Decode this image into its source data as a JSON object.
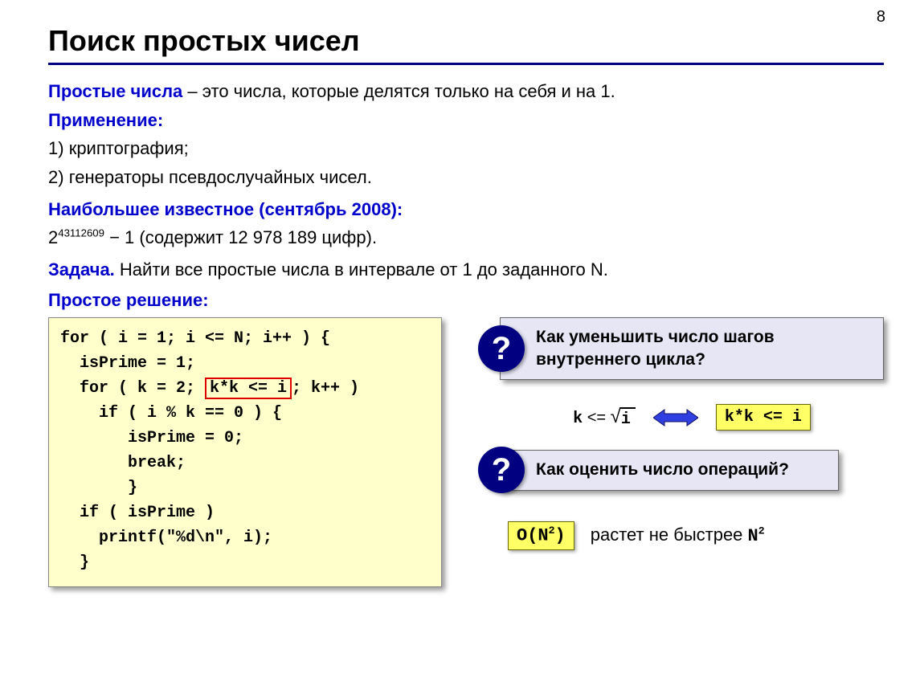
{
  "page_number": "8",
  "title": "Поиск простых чисел",
  "def_label": "Простые числа",
  "def_rest": " – это числа, которые делятся только на себя и на 1.",
  "app_label": "Применение:",
  "app_item1_num": "1)",
  "app_item1_text": "криптография;",
  "app_item2_num": "2)",
  "app_item2_text": "генераторы псевдослучайных чисел.",
  "largest_label": "Наибольшее известное (сентябрь 2008):",
  "largest_base": "2",
  "largest_exp": "43112609",
  "largest_rest": " − 1 (содержит 12 978 189 цифр).",
  "task_label": "Задача.",
  "task_text": " Найти все простые числа в интервале от 1 до заданного N.",
  "simple_label": "Простое решение:",
  "code": {
    "l1a": "for ( i = 1; i <= N; i++ ) {",
    "l2": "  isPrime = 1;",
    "l3a": "  for ( k = 2; ",
    "l3b": "k*k <= i",
    "l3c": "; k++ )",
    "l4": "    if ( i % k == 0 ) {",
    "l5": "       isPrime = 0;",
    "l6": "       break;",
    "l7": "       }",
    "l8": "  if ( isPrime )",
    "l9": "    printf(\"%d\\n\", i);",
    "l10": "  }"
  },
  "q1": "Как уменьшить число шагов внутреннего цикла?",
  "q_mark": "?",
  "eq_k": "k",
  "eq_le": " <= ",
  "eq_i": "i",
  "eq_right": "k*k <= i",
  "q2": "Как оценить число операций?",
  "bigO_label": "O(N",
  "bigO_exp": "2",
  "bigO_close": ")",
  "grows_text": "растет не быстрее ",
  "grows_N": "N",
  "grows_exp": "2"
}
